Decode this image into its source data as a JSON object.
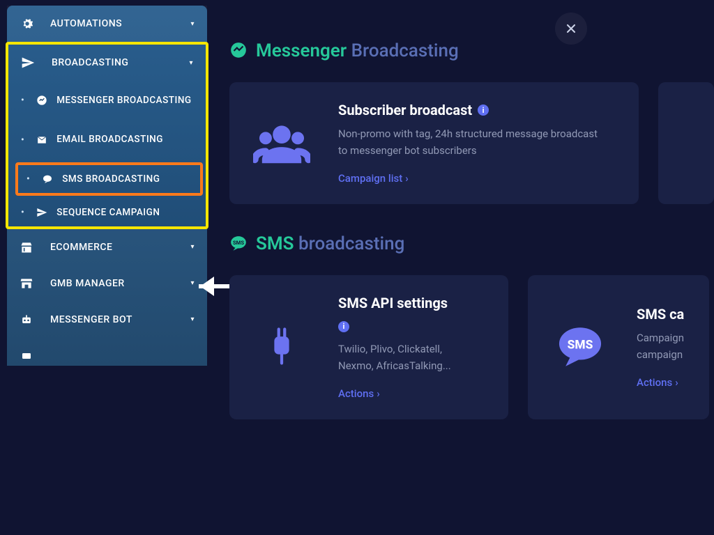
{
  "sidebar": {
    "automations": "AUTOMATIONS",
    "broadcasting": "BROADCASTING",
    "sub": {
      "messenger": "MESSENGER BROADCASTING",
      "email": "EMAIL BROADCASTING",
      "sms": "SMS BROADCASTING",
      "sequence": "SEQUENCE CAMPAIGN"
    },
    "ecommerce": "ECOMMERCE",
    "gmb": "GMB MANAGER",
    "messenger_bot": "MESSENGER BOT"
  },
  "sections": {
    "messenger": {
      "accent": "Messenger",
      "muted": "Broadcasting"
    },
    "sms": {
      "accent": "SMS",
      "muted": "broadcasting"
    }
  },
  "cards": {
    "subscriber": {
      "title": "Subscriber broadcast",
      "desc": "Non-promo with tag, 24h structured message broadcast to messenger bot subscribers",
      "link": "Campaign list"
    },
    "api": {
      "title": "SMS API settings",
      "desc": "Twilio, Plivo, Clickatell, Nexmo, AfricasTalking...",
      "link": "Actions"
    },
    "sms_campaign": {
      "title": "SMS ca",
      "desc": "Campaign campaign",
      "link": "Actions"
    }
  }
}
